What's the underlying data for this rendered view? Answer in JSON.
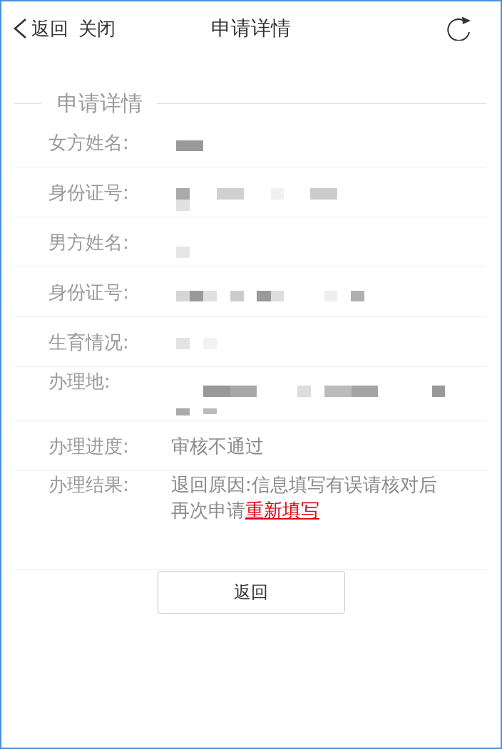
{
  "header": {
    "back": "返回",
    "close": "关闭",
    "title": "申请详情"
  },
  "section": {
    "title": "申请详情"
  },
  "rows": [
    {
      "label": "女方姓名:",
      "kind": "redacted"
    },
    {
      "label": "身份证号:",
      "kind": "redacted"
    },
    {
      "label": "男方姓名:",
      "kind": "redacted"
    },
    {
      "label": "身份证号:",
      "kind": "redacted"
    },
    {
      "label": "生育情况:",
      "kind": "redacted"
    },
    {
      "label": "办理地:",
      "kind": "redacted"
    },
    {
      "label": "办理进度:",
      "kind": "text",
      "value": "审核不通过"
    },
    {
      "label": "办理结果:",
      "kind": "result",
      "value": "退回原因:信息填写有误请核对后再次申请",
      "link": "重新填写"
    }
  ],
  "button": "返回"
}
